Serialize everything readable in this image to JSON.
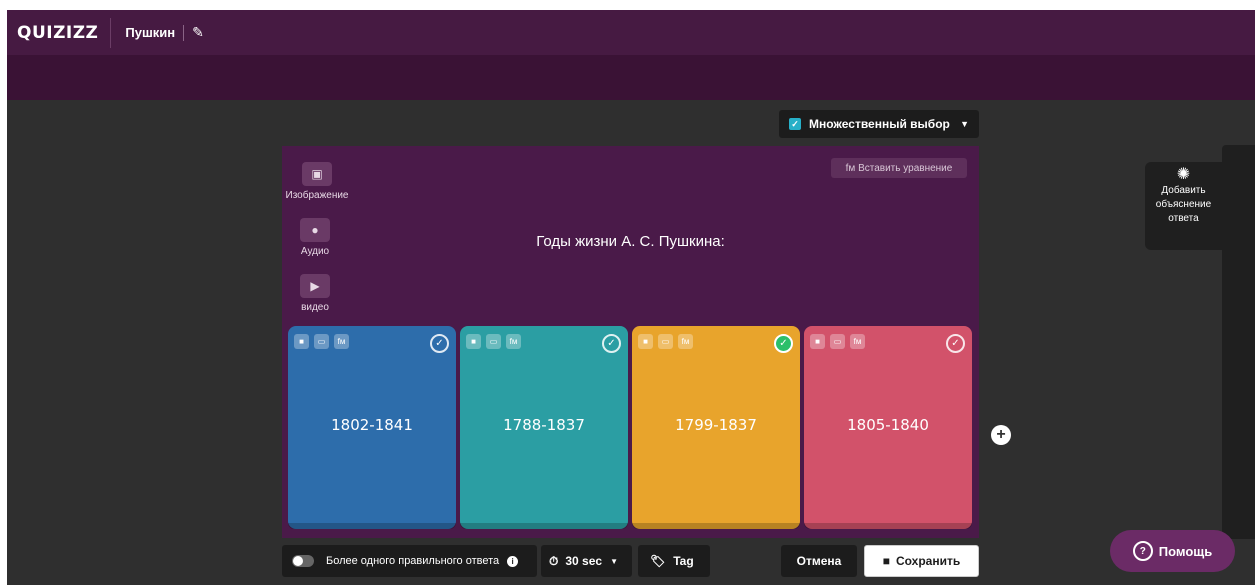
{
  "header": {
    "logo": "QUIZIZZ",
    "quiz_title": "Пушкин",
    "edit_icon": "pencil-icon"
  },
  "question_type": {
    "label": "Множественный выбор",
    "icon": "checkbox-icon"
  },
  "media": {
    "image_label": "Изображение",
    "audio_label": "Аудио",
    "video_label": "видео"
  },
  "equation_button": "fм Вставить уравнение",
  "question_text": "Годы жизни А. С. Пушкина:",
  "answers": [
    {
      "text": "1802-1841",
      "color": "#2d6dab",
      "correct": false
    },
    {
      "text": "1788-1837",
      "color": "#2b9ea3",
      "correct": false
    },
    {
      "text": "1799-1837",
      "color": "#e8a42c",
      "correct": true
    },
    {
      "text": "1805-1840",
      "color": "#d2526a",
      "correct": false
    }
  ],
  "explanation_button": {
    "line1": "Добавить",
    "line2": "объяснение",
    "line3": "ответа"
  },
  "footer": {
    "multiple_correct_label": "Более одного правильного ответа",
    "timer": "30 sec",
    "tag": "Tag",
    "cancel": "Отмена",
    "save": "Сохранить"
  },
  "help": "Помощь"
}
